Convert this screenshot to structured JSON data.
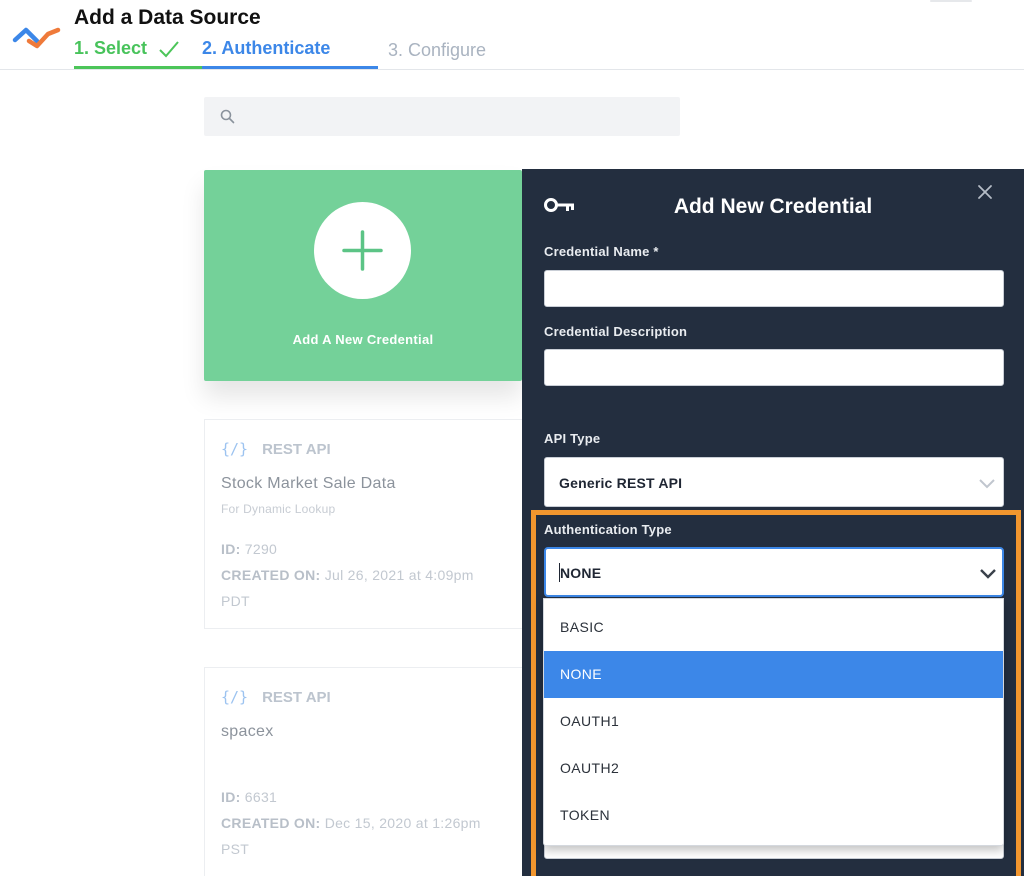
{
  "header": {
    "title": "Add a Data Source",
    "steps": [
      {
        "label": "1. Select",
        "state": "complete"
      },
      {
        "label": "2. Authenticate",
        "state": "active"
      },
      {
        "label": "3. Configure",
        "state": "upcoming"
      }
    ]
  },
  "search": {
    "placeholder": "",
    "icon": "search-icon"
  },
  "add_card": {
    "label": "Add A New Credential",
    "icon": "plus-icon",
    "color": "#74d199"
  },
  "credentials": [
    {
      "type": "REST API",
      "type_icon": "{/}",
      "name": "Stock Market Sale Data",
      "subtitle": "For Dynamic Lookup",
      "id_label": "ID:",
      "id": "7290",
      "created_label": "CREATED ON:",
      "created": "Jul 26, 2021 at 4:09pm",
      "tz": "PDT"
    },
    {
      "type": "REST API",
      "type_icon": "{/}",
      "name": "spacex",
      "subtitle": "",
      "id_label": "ID:",
      "id": "6631",
      "created_label": "CREATED ON:",
      "created": "Dec 15, 2020 at 1:26pm",
      "tz": "PST"
    }
  ],
  "modal": {
    "title": "Add New Credential",
    "fields": {
      "name_label": "Credential Name *",
      "name_value": "",
      "description_label": "Credential Description",
      "description_value": "",
      "api_type_label": "API Type",
      "api_type_value": "Generic REST API",
      "auth_type_label": "Authentication Type",
      "auth_type_value": "NONE"
    },
    "auth_options": [
      "BASIC",
      "NONE",
      "OAUTH1",
      "OAUTH2",
      "TOKEN"
    ],
    "selected_option": "NONE"
  },
  "colors": {
    "success": "#4cc559",
    "accent": "#3c87e8",
    "modal_bg": "#232e3f",
    "highlight": "#f2962e"
  }
}
